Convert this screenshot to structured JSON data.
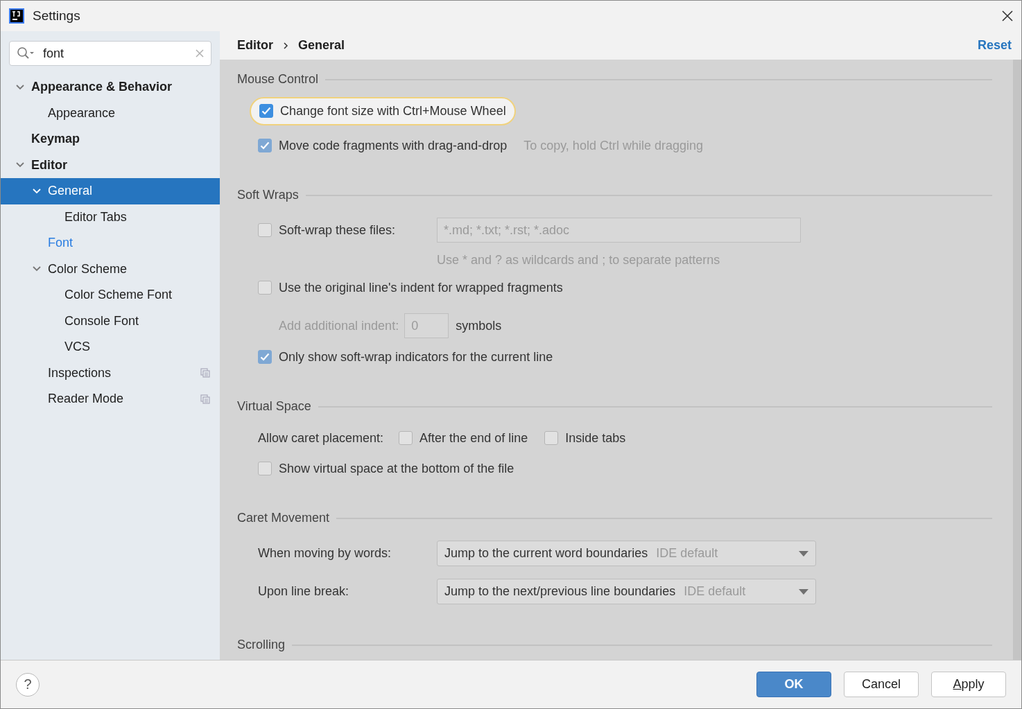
{
  "window": {
    "title": "Settings"
  },
  "search": {
    "value": "font"
  },
  "tree": [
    {
      "label": "Appearance & Behavior",
      "selected": false,
      "highlighted": false,
      "expanded": true,
      "shared": false,
      "children": [
        {
          "label": "Appearance",
          "selected": false,
          "highlighted": false,
          "shared": false
        }
      ]
    },
    {
      "label": "Keymap",
      "selected": false,
      "highlighted": false,
      "shared": false
    },
    {
      "label": "Editor",
      "selected": false,
      "highlighted": false,
      "expanded": true,
      "shared": false,
      "children": [
        {
          "label": "General",
          "selected": true,
          "highlighted": false,
          "expanded": true,
          "shared": false,
          "children": [
            {
              "label": "Editor Tabs",
              "selected": false,
              "highlighted": false,
              "shared": false
            }
          ]
        },
        {
          "label": "Font",
          "selected": false,
          "highlighted": true,
          "shared": false
        },
        {
          "label": "Color Scheme",
          "selected": false,
          "highlighted": false,
          "expanded": true,
          "shared": false,
          "children": [
            {
              "label": "Color Scheme Font",
              "selected": false,
              "highlighted": false,
              "shared": false
            },
            {
              "label": "Console Font",
              "selected": false,
              "highlighted": false,
              "shared": false
            },
            {
              "label": "VCS",
              "selected": false,
              "highlighted": false,
              "shared": false
            }
          ]
        },
        {
          "label": "Inspections",
          "selected": false,
          "highlighted": false,
          "shared": true
        },
        {
          "label": "Reader Mode",
          "selected": false,
          "highlighted": false,
          "shared": true
        }
      ]
    }
  ],
  "breadcrumb": [
    "Editor",
    "General"
  ],
  "reset": "Reset",
  "sections": [
    {
      "title": "Mouse Control",
      "rows": [
        {
          "kind": "checkbox",
          "label": "Change font size with Ctrl+Mouse Wheel",
          "checked": true,
          "highlighted": true
        },
        {
          "kind": "checkbox",
          "label": "Move code fragments with drag-and-drop",
          "checked": true,
          "highlighted": false,
          "hint": "To copy, hold Ctrl while dragging"
        }
      ]
    },
    {
      "title": "Soft Wraps",
      "rows": [
        {
          "kind": "checkfield",
          "label": "Soft-wrap these files:",
          "checked": false,
          "disabled": true,
          "value": "*.md; *.txt; *.rst; *.adoc",
          "note": "Use * and ? as wildcards and ; to separate patterns"
        },
        {
          "kind": "checkbox",
          "label": "Use the original line's indent for wrapped fragments",
          "checked": false,
          "highlighted": false
        },
        {
          "kind": "number",
          "label": "Add additional indent:",
          "disabled": true,
          "value": "0",
          "suffix": "symbols"
        },
        {
          "kind": "checkbox",
          "label": "Only show soft-wrap indicators for the current line",
          "checked": true,
          "highlighted": false
        }
      ]
    },
    {
      "title": "Virtual Space",
      "rows": [
        {
          "kind": "options",
          "label": "Allow caret placement:",
          "options": [
            {
              "label": "After the end of line",
              "checked": false
            },
            {
              "label": "Inside tabs",
              "checked": false
            }
          ]
        },
        {
          "kind": "checkbox",
          "label": "Show virtual space at the bottom of the file",
          "checked": false,
          "highlighted": false
        }
      ]
    },
    {
      "title": "Caret Movement",
      "rows": [
        {
          "kind": "select",
          "label": "When moving by words:",
          "value": "Jump to the current word boundaries",
          "note": "IDE default"
        },
        {
          "kind": "select",
          "label": "Upon line break:",
          "value": "Jump to the next/previous line boundaries",
          "note": "IDE default"
        }
      ]
    },
    {
      "title": "Scrolling"
    }
  ],
  "help": "?",
  "buttons": [
    {
      "label": "OK",
      "kind": "primary",
      "mnemonic": false
    },
    {
      "label": "Cancel",
      "kind": "plain",
      "mnemonic": false
    },
    {
      "label": "Apply",
      "kind": "plain",
      "mnemonic": true
    }
  ]
}
